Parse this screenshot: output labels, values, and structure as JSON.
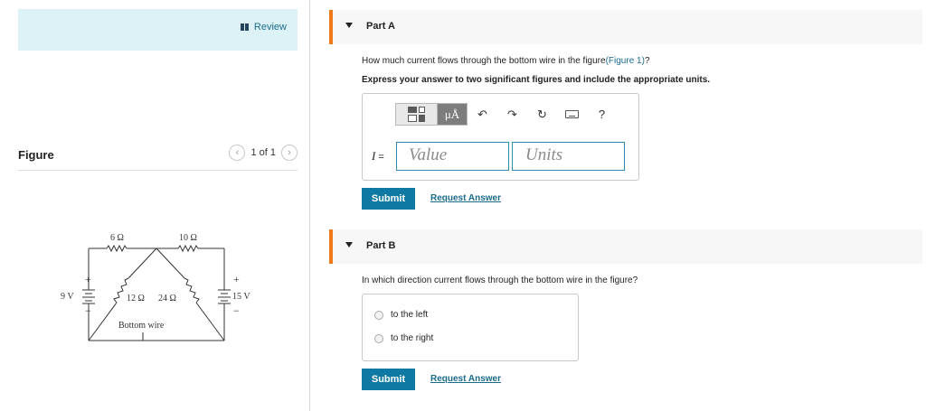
{
  "left": {
    "review_label": "Review",
    "figure_title": "Figure",
    "pager_text": "1 of 1",
    "circuit": {
      "r1": "6 Ω",
      "r2": "10 Ω",
      "r3": "12 Ω",
      "r4": "24 Ω",
      "v_left": "9 V",
      "v_right": "15 V",
      "plus": "+",
      "minus": "−",
      "bottom_wire": "Bottom wire"
    }
  },
  "part_a": {
    "title": "Part A",
    "question_prefix": "How much current flows through the bottom wire in the figure",
    "figure_link": "(Figure 1)",
    "question_suffix": "?",
    "instruction": "Express your answer to two significant figures and include the appropriate units.",
    "units_button": "μÅ",
    "help": "?",
    "variable": "I",
    "equals": " =",
    "value_placeholder": "Value",
    "units_placeholder": "Units",
    "submit": "Submit",
    "request_answer": "Request Answer"
  },
  "part_b": {
    "title": "Part B",
    "question": "In which direction current flows through the bottom wire in the figure?",
    "options": [
      "to the left",
      "to the right"
    ],
    "submit": "Submit",
    "request_answer": "Request Answer"
  },
  "colors": {
    "accent": "#f07a1a",
    "primary_button": "#0e7aa3",
    "link": "#1a6b8a",
    "review_bg": "#ddf2f7"
  }
}
